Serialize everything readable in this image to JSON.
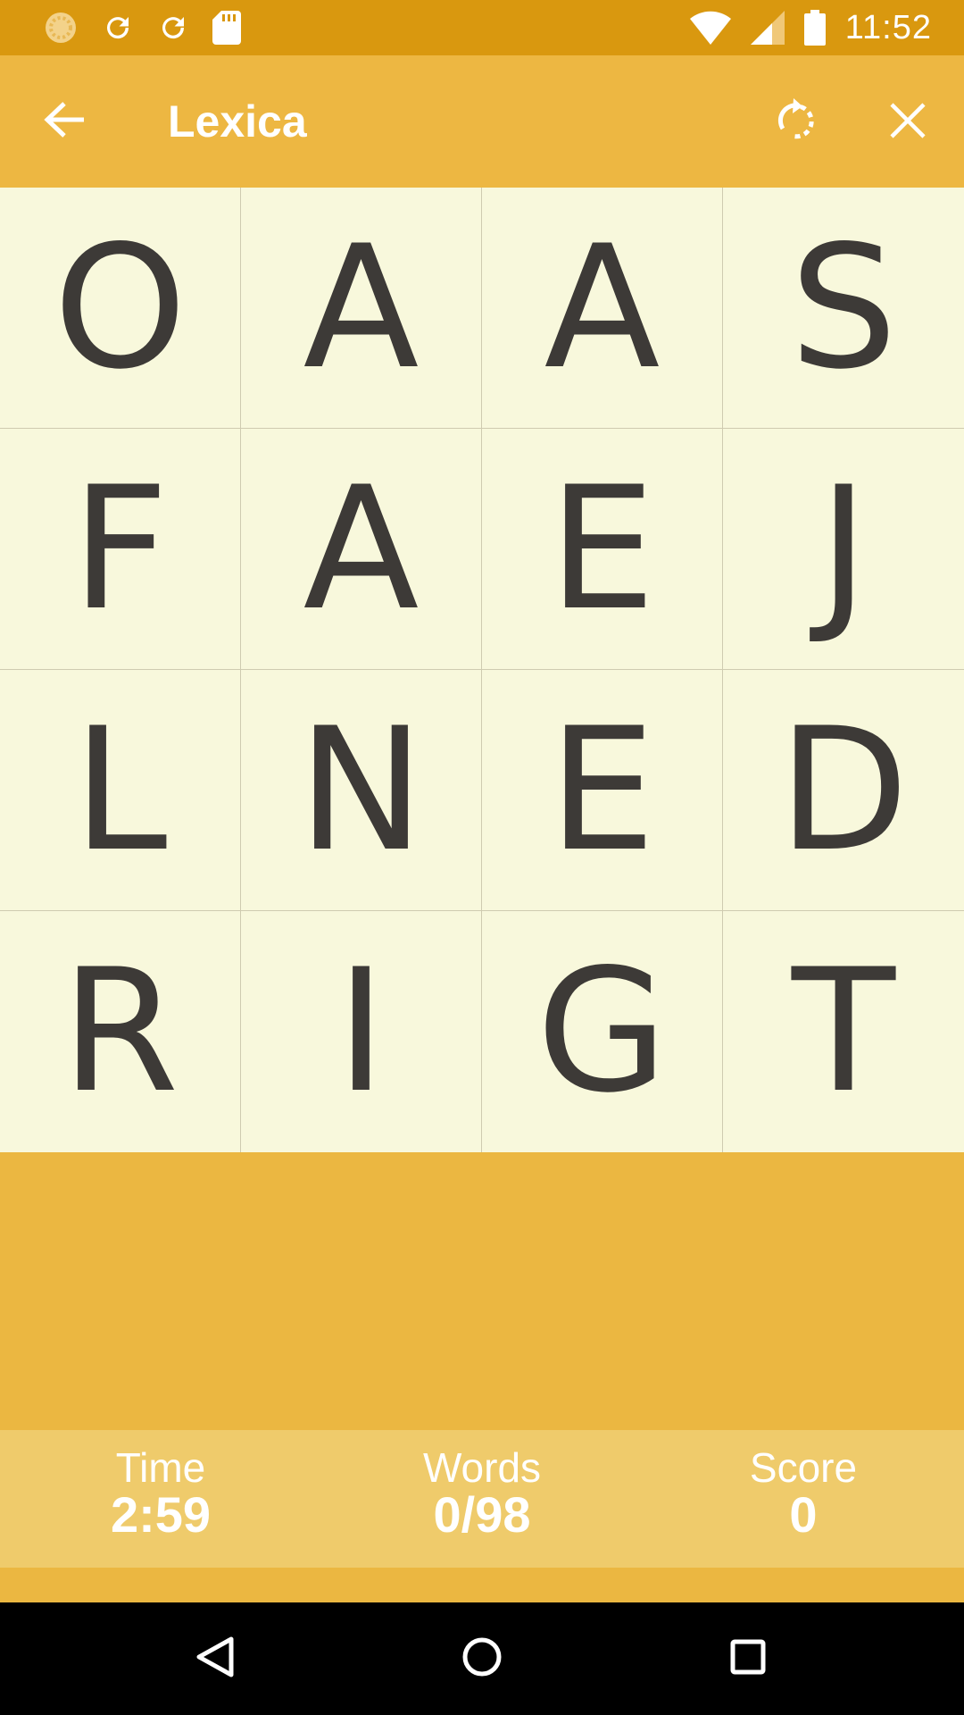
{
  "status_bar": {
    "time": "11:52",
    "left_icons": [
      "sync-loading-icon",
      "refresh-icon",
      "refresh-icon",
      "sd-card-icon"
    ],
    "right_icons": [
      "wifi-icon",
      "signal-icon",
      "battery-icon"
    ]
  },
  "app_bar": {
    "title": "Lexica",
    "back_icon": "arrow-back-icon",
    "rotate_icon": "rotate-icon",
    "close_icon": "close-icon"
  },
  "board": {
    "rows": [
      [
        "O",
        "A",
        "A",
        "S"
      ],
      [
        "F",
        "A",
        "E",
        "J"
      ],
      [
        "L",
        "N",
        "E",
        "D"
      ],
      [
        "R",
        "I",
        "G",
        "T"
      ]
    ]
  },
  "stats": {
    "time_label": "Time",
    "time_value": "2:59",
    "words_label": "Words",
    "words_value": "0/98",
    "score_label": "Score",
    "score_value": "0"
  },
  "nav_bar": {
    "icons": [
      "nav-back-icon",
      "nav-home-icon",
      "nav-recents-icon"
    ]
  },
  "colors": {
    "status_bar": "#D9980F",
    "app_bar": "#EDB742",
    "board_bg": "#F8F8DC",
    "letter": "#3D3A37",
    "stats_bg": "#EFCB6B",
    "page_bg": "#EBB741"
  }
}
